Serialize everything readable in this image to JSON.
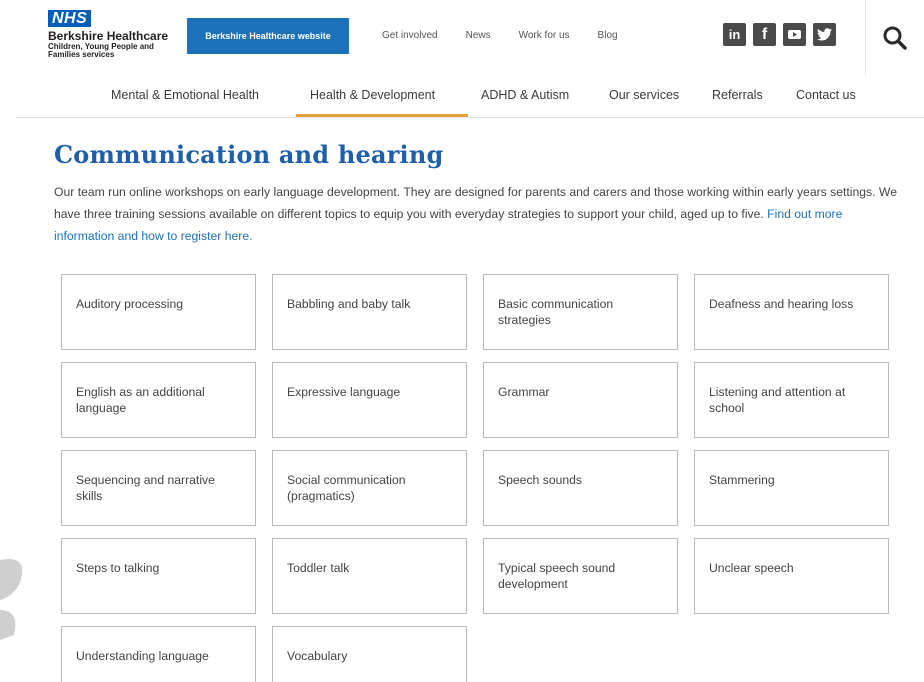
{
  "header": {
    "logo_badge": "NHS",
    "logo_name": "Berkshire Healthcare",
    "logo_sub": "Children, Young People and Families services",
    "website_button": "Berkshire Healthcare website",
    "links": [
      "Get involved",
      "News",
      "Work for us",
      "Blog"
    ],
    "social": [
      {
        "icon": "linkedin-icon",
        "glyph": "in"
      },
      {
        "icon": "facebook-icon",
        "glyph": "f"
      },
      {
        "icon": "youtube-icon",
        "glyph": "▶"
      },
      {
        "icon": "twitter-icon",
        "glyph": "🐦"
      }
    ]
  },
  "nav": {
    "items": [
      "Mental & Emotional Health",
      "Health & Development",
      "ADHD & Autism",
      "Our services",
      "Referrals",
      "Contact us"
    ],
    "active": "Health & Development"
  },
  "main": {
    "title": "Communication and hearing",
    "intro": "Our team run online workshops on early language development. They are designed for parents and carers and those working within early years settings. We have three training sessions available on different topics to equip you with everyday strategies to support your child, aged up to five.",
    "intro_link": "Find out more information and how to register here.",
    "topics": [
      "Auditory processing",
      "Babbling and baby talk",
      "Basic communication strategies",
      "Deafness and hearing loss",
      "English as an additional language",
      "Expressive language",
      "Grammar",
      "Listening and attention at school",
      "Sequencing and narrative skills",
      "Social communication (pragmatics)",
      "Speech sounds",
      "Stammering",
      "Steps to talking",
      "Toddler talk",
      "Typical speech sound development",
      "Unclear speech",
      "Understanding language",
      "Vocabulary"
    ]
  },
  "colors": {
    "nhs_blue": "#005eb8",
    "button_blue": "#1d71b8",
    "title_blue": "#1d5fa8",
    "nav_underline": "#e8a13a"
  }
}
